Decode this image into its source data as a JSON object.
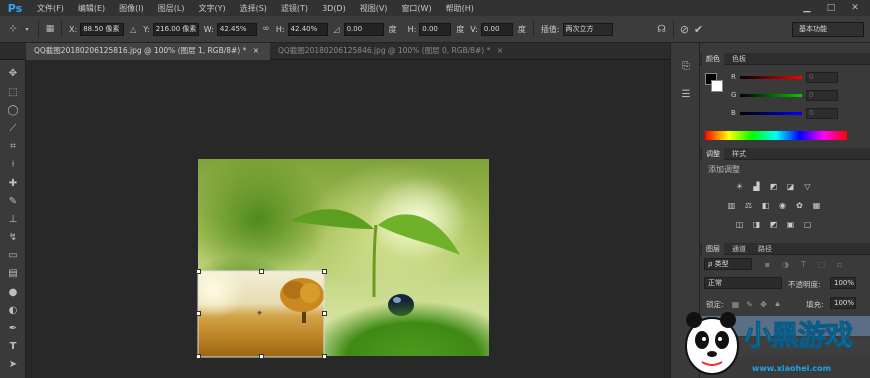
{
  "app": {
    "logo": "Ps"
  },
  "menu": [
    "文件(F)",
    "编辑(E)",
    "图像(I)",
    "图层(L)",
    "文字(Y)",
    "选择(S)",
    "滤镜(T)",
    "3D(D)",
    "视图(V)",
    "窗口(W)",
    "帮助(H)"
  ],
  "window_controls": {
    "minimize": "▁",
    "restore": "□",
    "close": "✕"
  },
  "options": {
    "x_label": "X:",
    "x_value": "88.50 像素",
    "y_label": "Y:",
    "y_value": "216.00 像素",
    "w_label": "W:",
    "w_value": "42.45%",
    "h_label": "H:",
    "h_value": "42.40%",
    "angle_value": "0.00",
    "degree_unit": "度",
    "hskew_label": "H:",
    "hskew_value": "0.00",
    "vskew_label": "V:",
    "vskew_value": "0.00",
    "interp_label": "插值:",
    "interp_value": "两次立方",
    "workspace": "基本功能"
  },
  "tabs": [
    {
      "label": "QQ截图20180206125816.jpg @ 100% (图层 1, RGB/8#) *",
      "close": "×"
    },
    {
      "label": "QQ截图20180206125846.jpg @ 100% (图层 0, RGB/8#) *",
      "close": "×"
    }
  ],
  "panels": {
    "color": {
      "tab_color": "颜色",
      "tab_swatches": "色板",
      "r_label": "R",
      "g_label": "G",
      "b_label": "B",
      "r_value": "0",
      "g_value": "0",
      "b_value": "0"
    },
    "adjust": {
      "tab_adjust": "调整",
      "tab_styles": "样式",
      "title": "添加调整"
    },
    "layers": {
      "tab_layers": "图层",
      "tab_channels": "通道",
      "tab_paths": "路径",
      "kind": "ρ 类型",
      "blend_mode": "正常",
      "opacity_label": "不透明度:",
      "opacity_value": "100%",
      "lock_label": "锁定:",
      "fill_label": "填充:",
      "fill_value": "100%"
    }
  },
  "watermark": {
    "brand": "小黑游戏",
    "url": "www.xiaohei.com"
  },
  "colors": {
    "accent": "#31a8ff",
    "menubar": "#323232",
    "panel": "#3a3a3a",
    "canvas": "#282828"
  }
}
